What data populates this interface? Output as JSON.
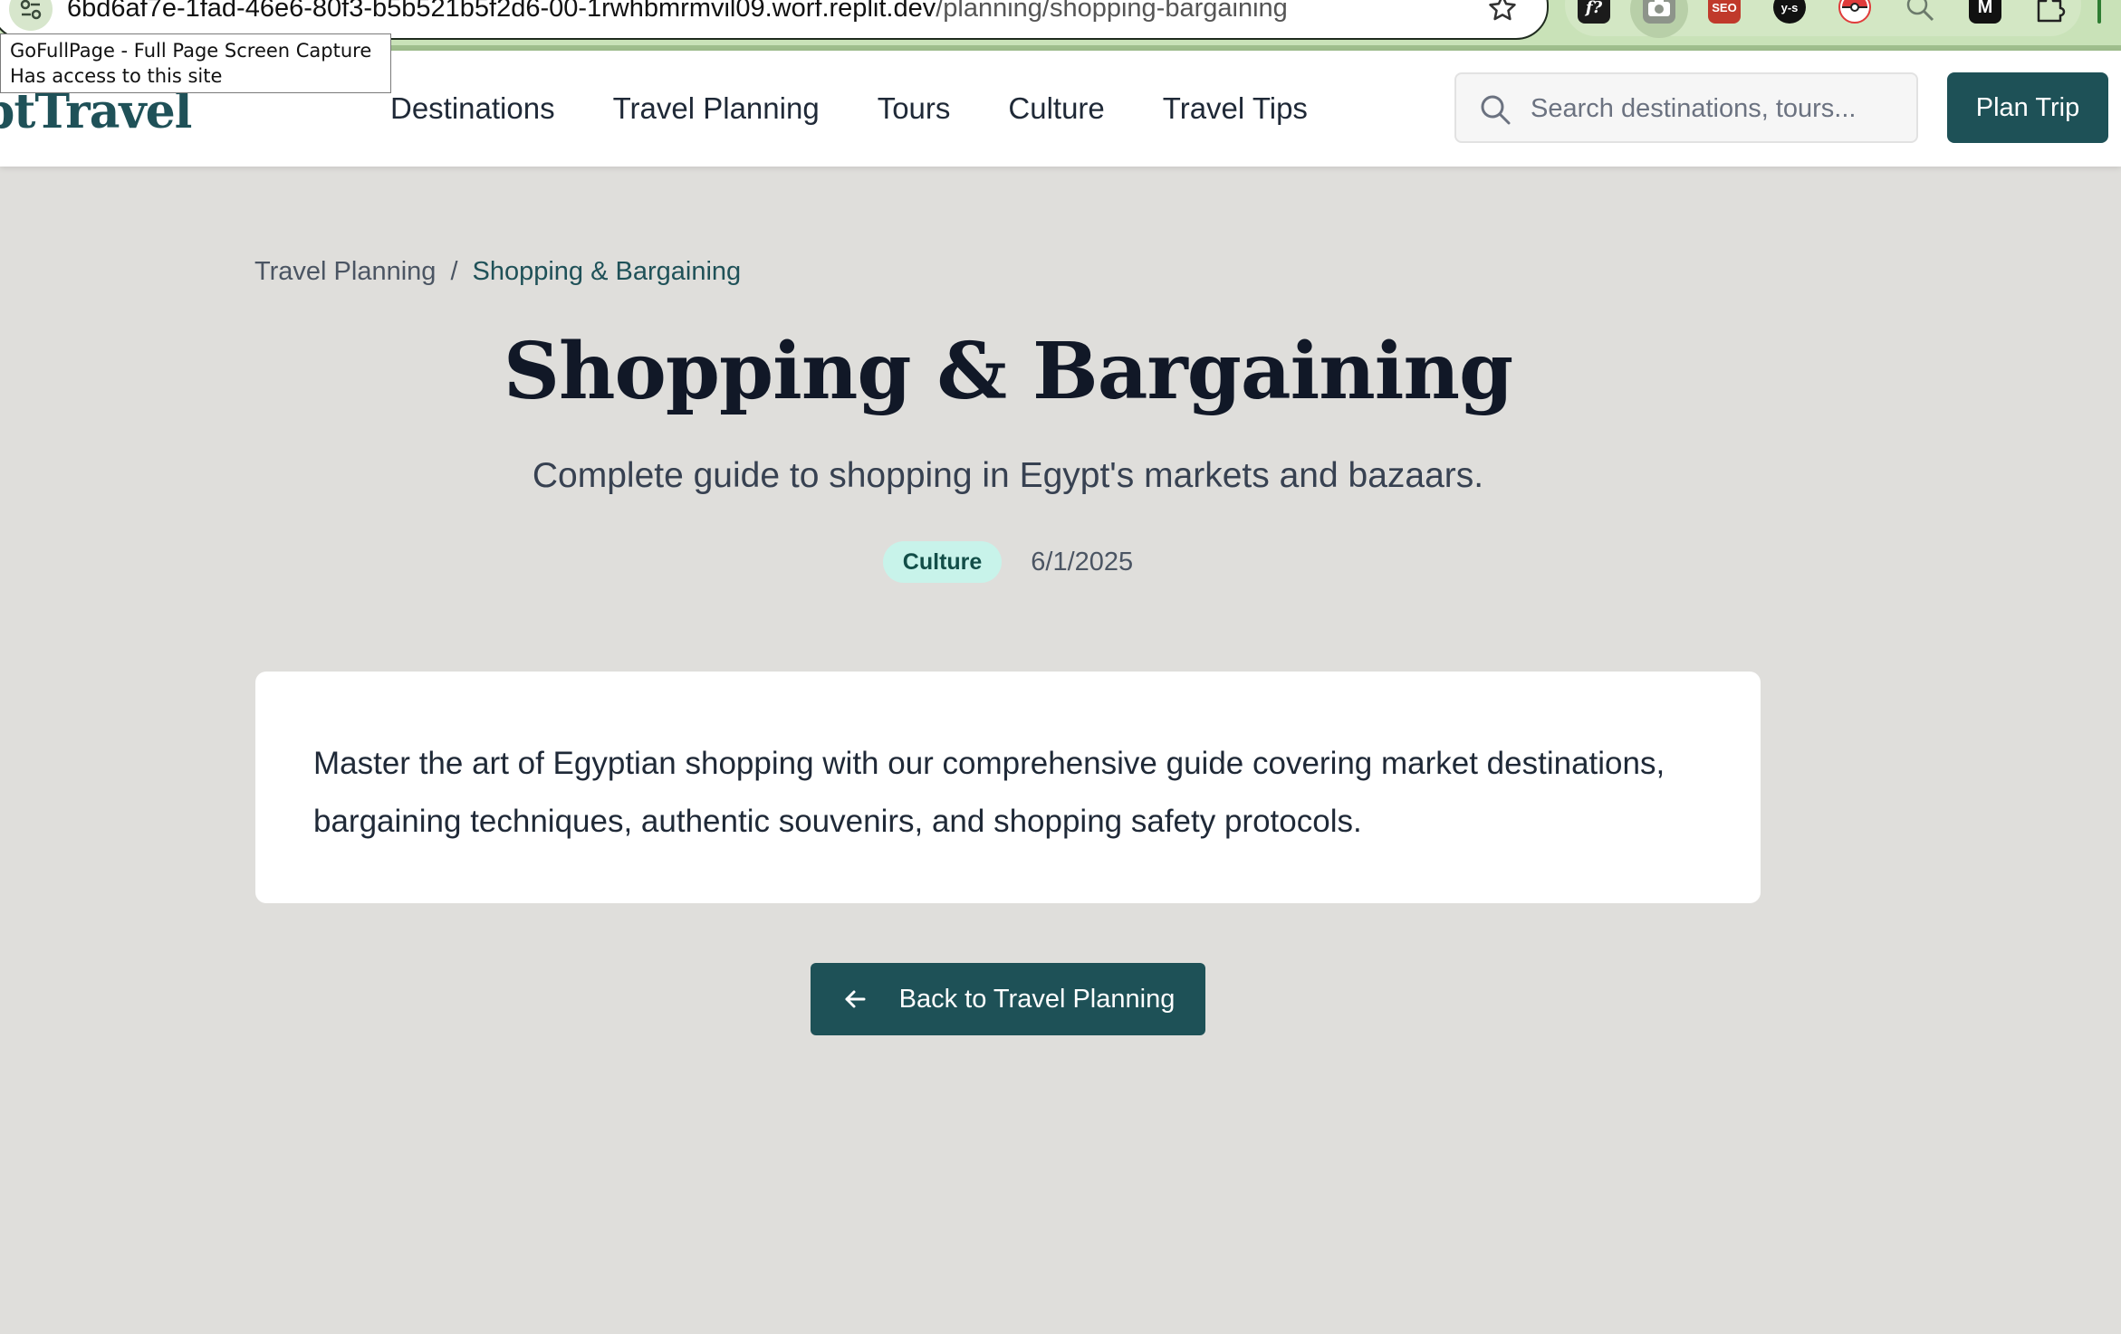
{
  "browser": {
    "url_host": "6bd6af7e-1fad-46e6-80f3-b5b521b5f2d6-00-1rwhbmrmvil09.worf.replit.dev",
    "url_path": "/planning/shopping-bargaining",
    "extensions": [
      "f?",
      "camera",
      "SEO",
      "y-s",
      "pokeball",
      "alt",
      "M",
      "puzzle"
    ]
  },
  "tooltip": {
    "line1": "GoFullPage - Full Page Screen Capture",
    "line2": "Has access to this site"
  },
  "header": {
    "logo": "ptTravel",
    "nav": [
      "Destinations",
      "Travel Planning",
      "Tours",
      "Culture",
      "Travel Tips"
    ],
    "search_placeholder": "Search destinations, tours...",
    "plan_button": "Plan Trip"
  },
  "breadcrumb": {
    "parent": "Travel Planning",
    "separator": "/",
    "current": "Shopping & Bargaining"
  },
  "page": {
    "title": "Shopping & Bargaining",
    "subtitle": "Complete guide to shopping in Egypt's markets and bazaars.",
    "tag": "Culture",
    "date": "6/1/2025",
    "body": "Master the art of Egyptian shopping with our comprehensive guide covering market destinations, bargaining techniques, authentic souvenirs, and shopping safety protocols.",
    "back_button": "Back to Travel Planning"
  },
  "colors": {
    "primary": "#1e5157",
    "page_background": "#dfdedb",
    "tag_background": "#c8f3ea",
    "tag_text": "#124e48",
    "browser_bar": "#c9e2b8"
  }
}
